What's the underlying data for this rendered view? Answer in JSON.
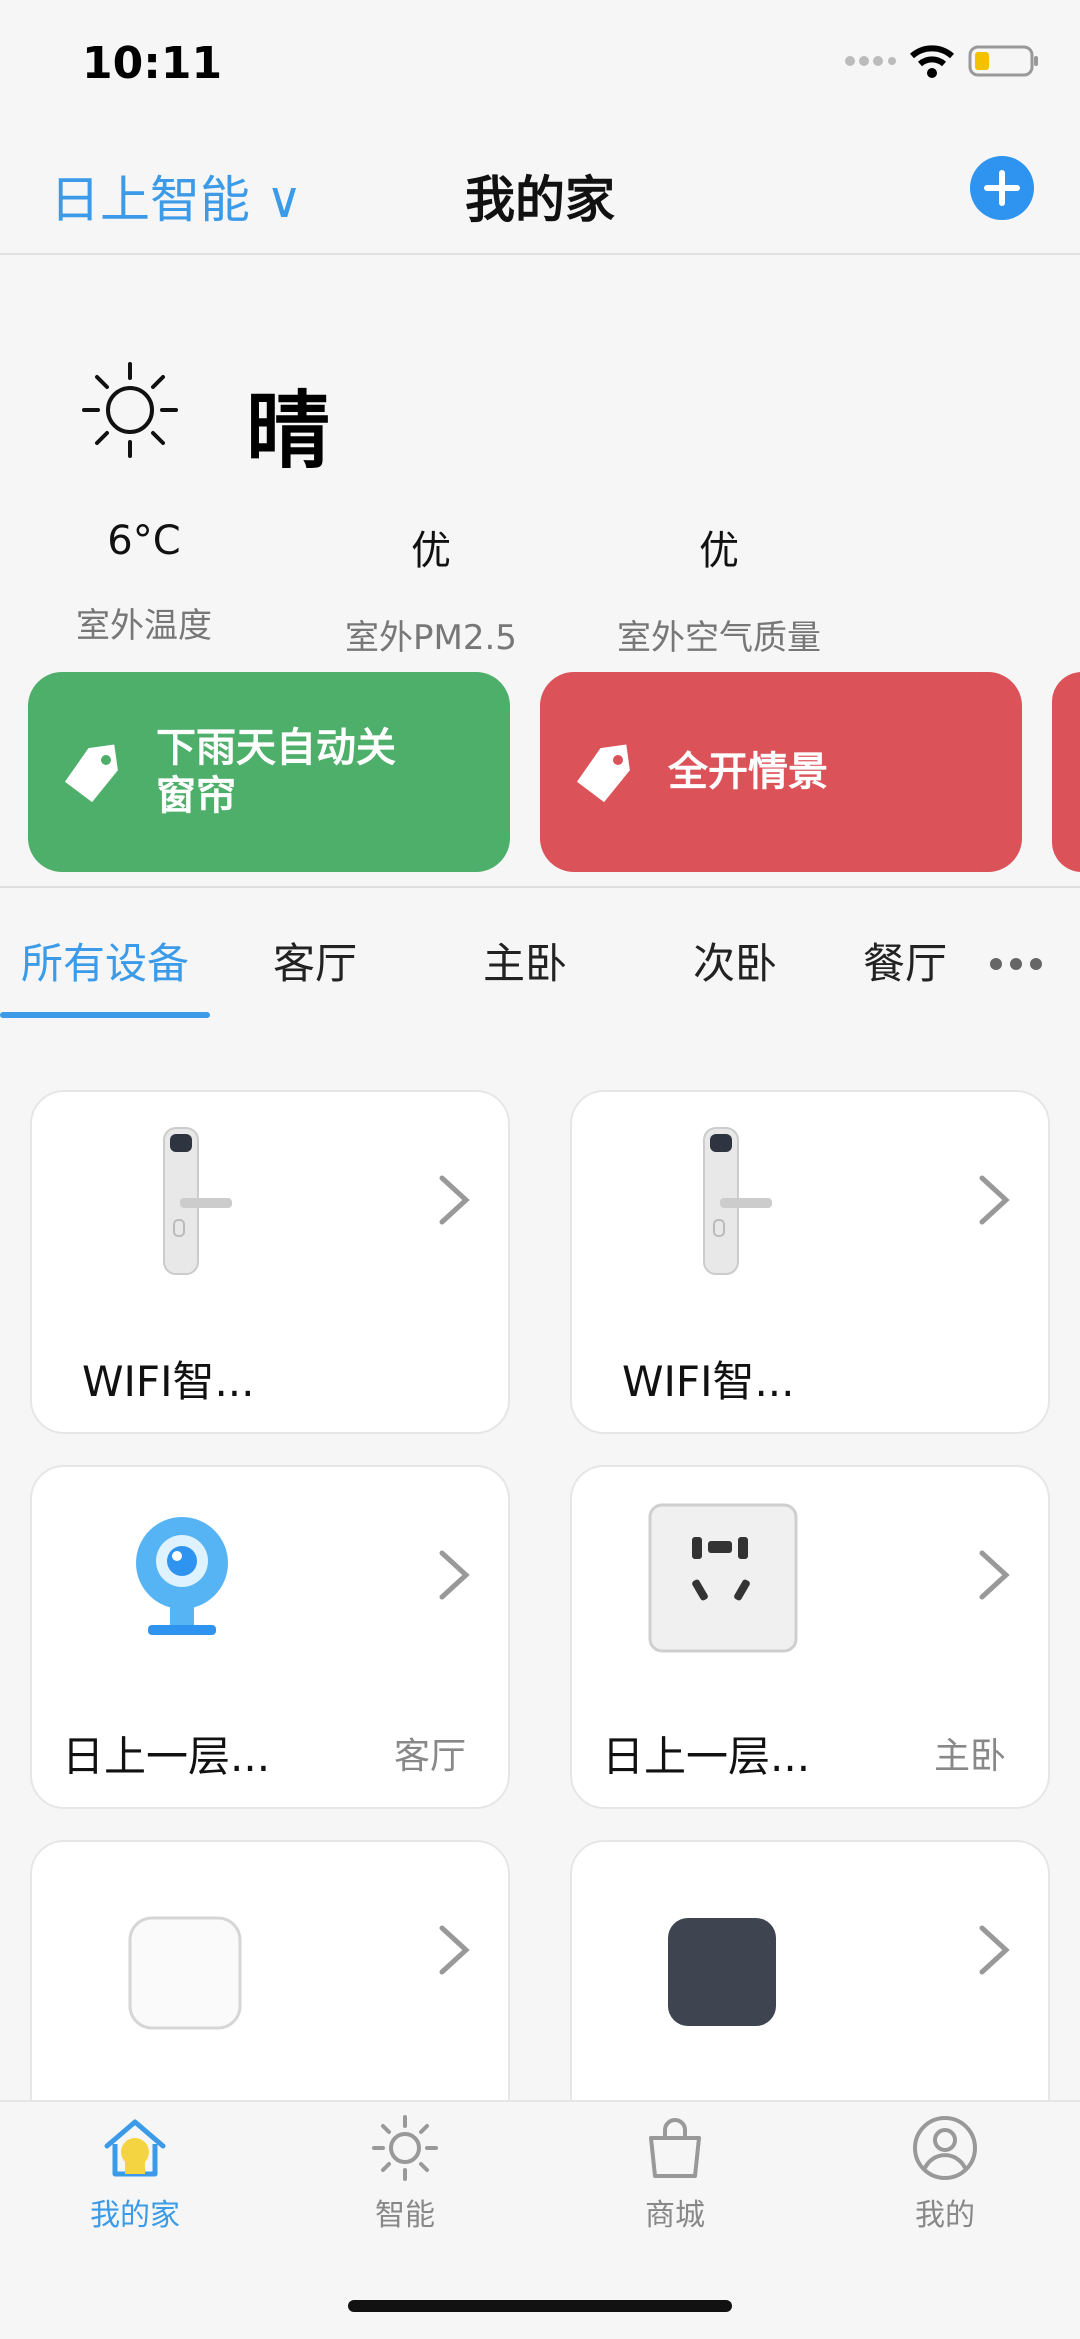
{
  "status_bar": {
    "time": "10:11"
  },
  "header": {
    "home_name": "日上智能 ∨",
    "title": "我的家"
  },
  "weather": {
    "condition": "晴",
    "metrics": [
      {
        "value": "6°C",
        "label": "室外温度"
      },
      {
        "value": "优",
        "label": "室外PM2.5"
      },
      {
        "value": "优",
        "label": "室外空气质量"
      }
    ]
  },
  "scenes": [
    {
      "label": "下雨天自动关窗帘",
      "color": "#4eaf6b"
    },
    {
      "label": "全开情景",
      "color": "#dc5259"
    }
  ],
  "room_tabs": [
    "所有设备",
    "客厅",
    "主卧",
    "次卧",
    "餐厅"
  ],
  "devices": [
    {
      "name": "WIFI智...",
      "room": "",
      "icon": "door-lock-icon"
    },
    {
      "name": "WIFI智...",
      "room": "",
      "icon": "door-lock-icon"
    },
    {
      "name": "日上一层...",
      "room": "客厅",
      "icon": "camera-icon"
    },
    {
      "name": "日上一层...",
      "room": "主卧",
      "icon": "socket-icon"
    },
    {
      "name": "",
      "room": "",
      "icon": "white-hub-icon"
    },
    {
      "name": "",
      "room": "",
      "icon": "dark-hub-icon"
    }
  ],
  "tab_bar": [
    {
      "label": "我的家",
      "icon": "home-icon",
      "active": true
    },
    {
      "label": "智能",
      "icon": "sun-icon",
      "active": false
    },
    {
      "label": "商城",
      "icon": "shopping-bag-icon",
      "active": false
    },
    {
      "label": "我的",
      "icon": "user-icon",
      "active": false
    }
  ],
  "colors": {
    "accent": "#3c9be8",
    "scene_green": "#4eaf6b",
    "scene_red": "#dc5259"
  }
}
